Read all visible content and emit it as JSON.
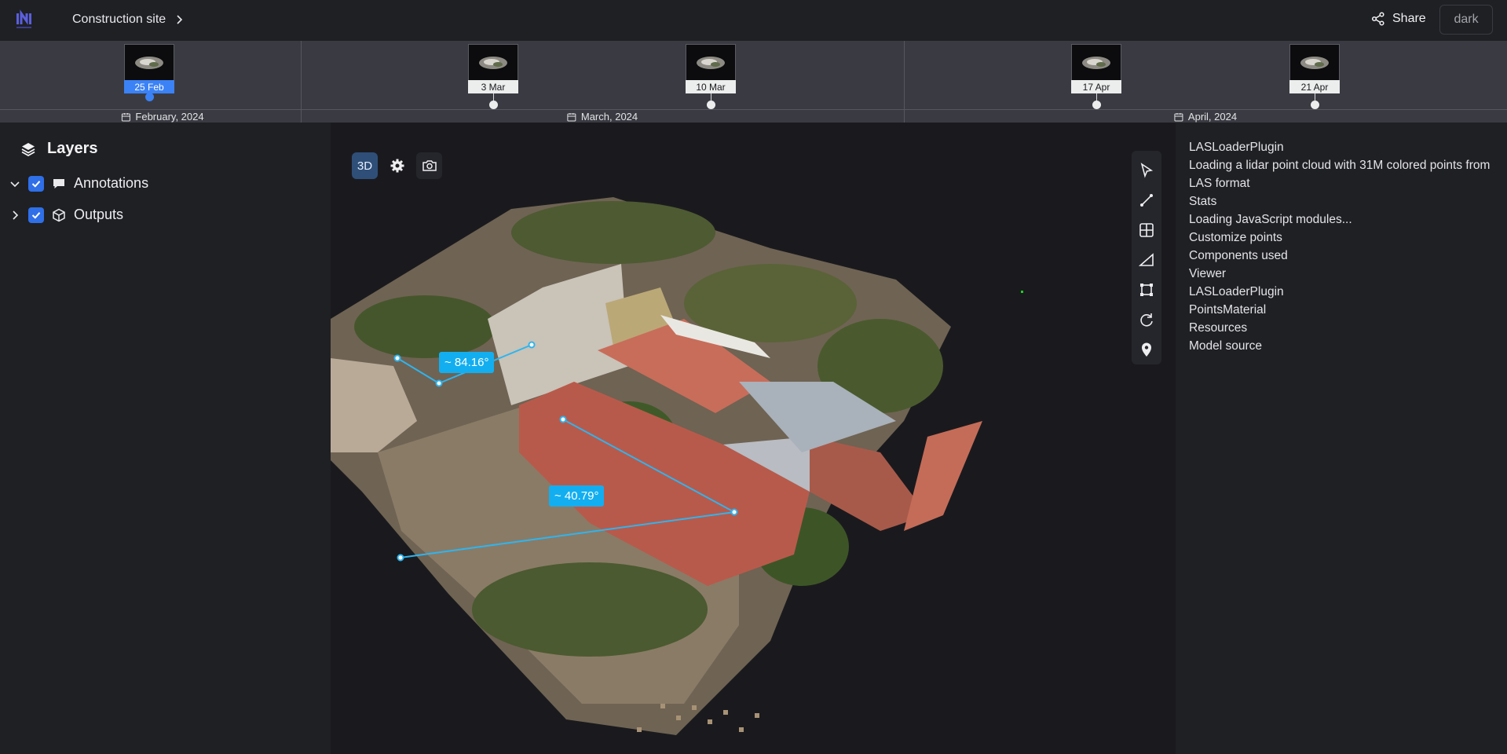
{
  "app": {
    "brand": "INI",
    "breadcrumb": "Construction site",
    "share_label": "Share",
    "theme_label": "dark"
  },
  "timeline": {
    "months": [
      {
        "label": "February, 2024"
      },
      {
        "label": "March, 2024"
      },
      {
        "label": "April, 2024"
      }
    ],
    "snapshots": [
      {
        "date": "25 Feb",
        "active": true
      },
      {
        "date": "3 Mar",
        "active": false
      },
      {
        "date": "10 Mar",
        "active": false
      },
      {
        "date": "17 Apr",
        "active": false
      },
      {
        "date": "21 Apr",
        "active": false
      }
    ]
  },
  "layers": {
    "title": "Layers",
    "items": [
      {
        "label": "Annotations",
        "expanded": true,
        "checked": true,
        "icon": "comment-icon"
      },
      {
        "label": "Outputs",
        "expanded": false,
        "checked": true,
        "icon": "cube-icon"
      }
    ]
  },
  "viewer": {
    "mode_label": "3D",
    "measurements": [
      {
        "label": "~ 84.16°"
      },
      {
        "label": "~ 40.79°"
      }
    ],
    "tools": [
      "pointer-icon",
      "line-measure-icon",
      "area-grid-icon",
      "angle-icon",
      "bounding-box-icon",
      "rotate-icon",
      "pin-icon"
    ]
  },
  "info_panel": {
    "items": [
      "LASLoaderPlugin",
      "Loading a lidar point cloud with 31M colored points from LAS format",
      "Stats",
      "Loading JavaScript modules...",
      "Customize points",
      "Components used",
      "Viewer",
      "LASLoaderPlugin",
      "PointsMaterial",
      "Resources",
      "Model source"
    ]
  },
  "colors": {
    "accent": "#3b82f6",
    "measure": "#13aef0",
    "background": "#1e1f23"
  }
}
